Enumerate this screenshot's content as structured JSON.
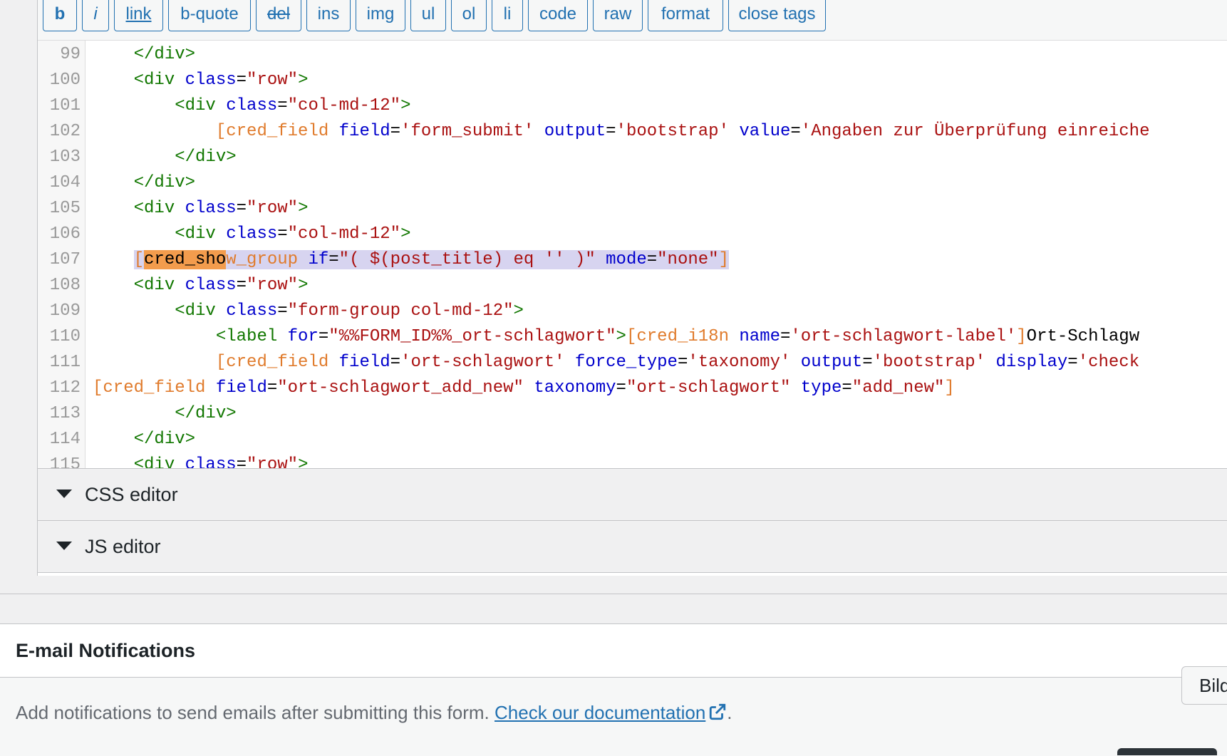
{
  "toolbar": {
    "buttons": [
      "b",
      "i",
      "link",
      "b-quote",
      "del",
      "ins",
      "img",
      "ul",
      "ol",
      "li",
      "code",
      "raw",
      "format",
      "close tags"
    ]
  },
  "editor": {
    "lines": [
      {
        "n": "99",
        "tokens": [
          {
            "t": "    "
          },
          {
            "c": "tag",
            "t": "</div>"
          }
        ]
      },
      {
        "n": "100",
        "tokens": [
          {
            "t": "    "
          },
          {
            "c": "tag",
            "t": "<div "
          },
          {
            "c": "attr",
            "t": "class"
          },
          {
            "t": "="
          },
          {
            "c": "str",
            "t": "\"row\""
          },
          {
            "c": "tag",
            "t": ">"
          }
        ]
      },
      {
        "n": "101",
        "tokens": [
          {
            "t": "        "
          },
          {
            "c": "tag",
            "t": "<div "
          },
          {
            "c": "attr",
            "t": "class"
          },
          {
            "t": "="
          },
          {
            "c": "str",
            "t": "\"col-md-12\""
          },
          {
            "c": "tag",
            "t": ">"
          }
        ]
      },
      {
        "n": "102",
        "tokens": [
          {
            "t": "            "
          },
          {
            "c": "sc",
            "t": "[cred_field "
          },
          {
            "c": "attr",
            "t": "field"
          },
          {
            "t": "="
          },
          {
            "c": "str",
            "t": "'form_submit' "
          },
          {
            "c": "attr",
            "t": "output"
          },
          {
            "t": "="
          },
          {
            "c": "str",
            "t": "'bootstrap' "
          },
          {
            "c": "attr",
            "t": "value"
          },
          {
            "t": "="
          },
          {
            "c": "str",
            "t": "'Angaben zur Überprüfung einreiche"
          }
        ]
      },
      {
        "n": "103",
        "tokens": [
          {
            "t": "        "
          },
          {
            "c": "tag",
            "t": "</div>"
          }
        ]
      },
      {
        "n": "104",
        "tokens": [
          {
            "t": "    "
          },
          {
            "c": "tag",
            "t": "</div>"
          }
        ]
      },
      {
        "n": "105",
        "tokens": [
          {
            "t": "    "
          },
          {
            "c": "tag",
            "t": "<div "
          },
          {
            "c": "attr",
            "t": "class"
          },
          {
            "t": "="
          },
          {
            "c": "str",
            "t": "\"row\""
          },
          {
            "c": "tag",
            "t": ">"
          }
        ]
      },
      {
        "n": "106",
        "tokens": [
          {
            "t": "        "
          },
          {
            "c": "tag",
            "t": "<div "
          },
          {
            "c": "attr",
            "t": "class"
          },
          {
            "t": "="
          },
          {
            "c": "str",
            "t": "\"col-md-12\""
          },
          {
            "c": "tag",
            "t": ">"
          }
        ]
      },
      {
        "n": "107",
        "selected": true,
        "tokens": [
          {
            "t": "    "
          },
          {
            "c": "sc",
            "t": "[",
            "sel": true
          },
          {
            "c": "match",
            "t": "cred_sho",
            "sel": true
          },
          {
            "c": "sc",
            "t": "w_group ",
            "sel": true
          },
          {
            "c": "attr",
            "t": "if",
            "sel": true
          },
          {
            "t": "=",
            "sel": true
          },
          {
            "c": "str",
            "t": "\"( $(post_title) eq '' )\" ",
            "sel": true
          },
          {
            "c": "attr",
            "t": "mode",
            "sel": true
          },
          {
            "t": "=",
            "sel": true
          },
          {
            "c": "str",
            "t": "\"none\"",
            "sel": true
          },
          {
            "c": "sc",
            "t": "]",
            "sel": true
          }
        ]
      },
      {
        "n": "108",
        "tokens": [
          {
            "t": "    "
          },
          {
            "c": "tag",
            "t": "<div "
          },
          {
            "c": "attr",
            "t": "class"
          },
          {
            "t": "="
          },
          {
            "c": "str",
            "t": "\"row\""
          },
          {
            "c": "tag",
            "t": ">"
          }
        ]
      },
      {
        "n": "109",
        "tokens": [
          {
            "t": "        "
          },
          {
            "c": "tag",
            "t": "<div "
          },
          {
            "c": "attr",
            "t": "class"
          },
          {
            "t": "="
          },
          {
            "c": "str",
            "t": "\"form-group col-md-12\""
          },
          {
            "c": "tag",
            "t": ">"
          }
        ]
      },
      {
        "n": "110",
        "tokens": [
          {
            "t": "            "
          },
          {
            "c": "tag",
            "t": "<label "
          },
          {
            "c": "attr",
            "t": "for"
          },
          {
            "t": "="
          },
          {
            "c": "str",
            "t": "\"%%FORM_ID%%_ort-schlagwort\""
          },
          {
            "c": "tag",
            "t": ">"
          },
          {
            "c": "sc",
            "t": "[cred_i18n "
          },
          {
            "c": "attr",
            "t": "name"
          },
          {
            "t": "="
          },
          {
            "c": "str",
            "t": "'ort-schlagwort-label'"
          },
          {
            "c": "sc",
            "t": "]"
          },
          {
            "t": "Ort-Schlagw"
          }
        ]
      },
      {
        "n": "111",
        "tokens": [
          {
            "t": "            "
          },
          {
            "c": "sc",
            "t": "[cred_field "
          },
          {
            "c": "attr",
            "t": "field"
          },
          {
            "t": "="
          },
          {
            "c": "str",
            "t": "'ort-schlagwort' "
          },
          {
            "c": "attr",
            "t": "force_type"
          },
          {
            "t": "="
          },
          {
            "c": "str",
            "t": "'taxonomy' "
          },
          {
            "c": "attr",
            "t": "output"
          },
          {
            "t": "="
          },
          {
            "c": "str",
            "t": "'bootstrap' "
          },
          {
            "c": "attr",
            "t": "display"
          },
          {
            "t": "="
          },
          {
            "c": "str",
            "t": "'check"
          }
        ]
      },
      {
        "n": "112",
        "tokens": [
          {
            "c": "sc",
            "t": "[cred_field "
          },
          {
            "c": "attr",
            "t": "field"
          },
          {
            "t": "="
          },
          {
            "c": "str",
            "t": "\"ort-schlagwort_add_new\" "
          },
          {
            "c": "attr",
            "t": "taxonomy"
          },
          {
            "t": "="
          },
          {
            "c": "str",
            "t": "\"ort-schlagwort\" "
          },
          {
            "c": "attr",
            "t": "type"
          },
          {
            "t": "="
          },
          {
            "c": "str",
            "t": "\"add_new\""
          },
          {
            "c": "sc",
            "t": "]"
          }
        ]
      },
      {
        "n": "113",
        "tokens": [
          {
            "t": "        "
          },
          {
            "c": "tag",
            "t": "</div>"
          }
        ]
      },
      {
        "n": "114",
        "tokens": [
          {
            "t": "    "
          },
          {
            "c": "tag",
            "t": "</div>"
          }
        ]
      },
      {
        "n": "115",
        "tokens": [
          {
            "t": "    "
          },
          {
            "c": "tag",
            "t": "<div "
          },
          {
            "c": "attr",
            "t": "class"
          },
          {
            "t": "="
          },
          {
            "c": "str",
            "t": "\"row\""
          },
          {
            "c": "tag",
            "t": ">"
          }
        ]
      }
    ]
  },
  "accordions": {
    "css_label": "CSS editor",
    "js_label": "JS editor"
  },
  "notifications": {
    "title": "E-mail Notifications",
    "description": "Add notifications to send emails after submitting this form.",
    "doc_link": "Check our documentation",
    "trailing": "."
  },
  "side_button": {
    "label": "Bilder"
  },
  "icons": {
    "accordion": "triangle-down-icon",
    "link": "external-link-icon"
  },
  "colors": {
    "accent": "#2271b1",
    "tag": "#117700",
    "attr": "#0000cc",
    "string": "#aa1111",
    "shortcode": "#e07b2c",
    "selection": "#d7d4f0",
    "match": "#f39c4d"
  }
}
